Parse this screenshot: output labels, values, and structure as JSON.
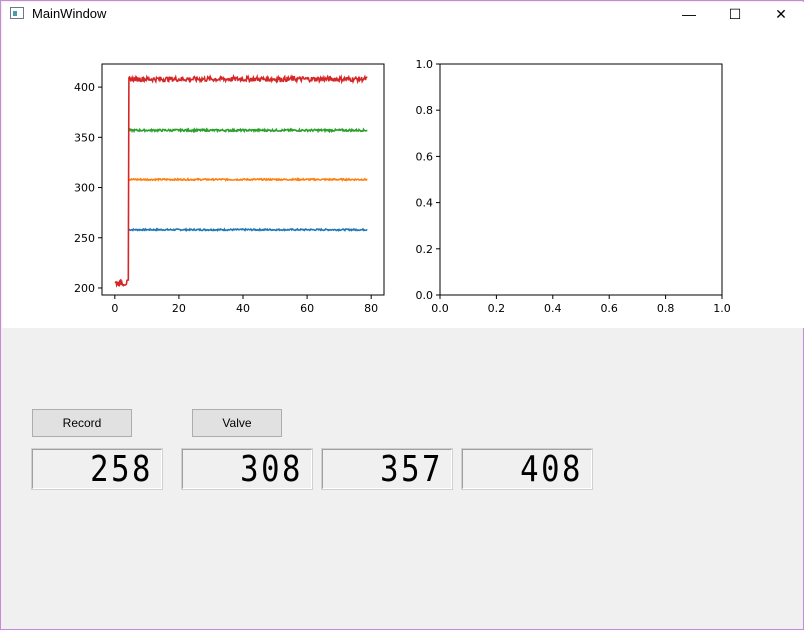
{
  "window": {
    "title": "MainWindow",
    "controls": {
      "minimize": "—",
      "maximize": "☐",
      "close": "✕"
    }
  },
  "buttons": {
    "record": "Record",
    "valve": "Valve"
  },
  "displays": [
    "258",
    "308",
    "357",
    "408"
  ],
  "chart_data": [
    {
      "type": "line",
      "xlim": [
        -4,
        84
      ],
      "ylim": [
        193,
        423
      ],
      "x_ticks": [
        "0",
        "20",
        "40",
        "60",
        "80"
      ],
      "y_ticks": [
        "200",
        "250",
        "300",
        "350",
        "400"
      ],
      "x_tick_values": [
        0,
        20,
        40,
        60,
        80
      ],
      "y_tick_values": [
        200,
        250,
        300,
        350,
        400
      ],
      "grid": false,
      "step_x": 4.4,
      "x_end": 79,
      "series": [
        {
          "color": "#1f77b4",
          "start": null,
          "level": 258
        },
        {
          "color": "#ff7f0e",
          "start": null,
          "level": 308
        },
        {
          "color": "#2ca02c",
          "start": null,
          "level": 357
        },
        {
          "color": "#d62728",
          "start": 205,
          "level": 408
        }
      ]
    },
    {
      "type": "line",
      "xlim": [
        0,
        1
      ],
      "ylim": [
        0,
        1
      ],
      "x_ticks": [
        "0.0",
        "0.2",
        "0.4",
        "0.6",
        "0.8",
        "1.0"
      ],
      "y_ticks": [
        "0.0",
        "0.2",
        "0.4",
        "0.6",
        "0.8",
        "1.0"
      ],
      "x_tick_values": [
        0,
        0.2,
        0.4,
        0.6,
        0.8,
        1.0
      ],
      "y_tick_values": [
        0,
        0.2,
        0.4,
        0.6,
        0.8,
        1.0
      ],
      "grid": false,
      "series": []
    }
  ]
}
